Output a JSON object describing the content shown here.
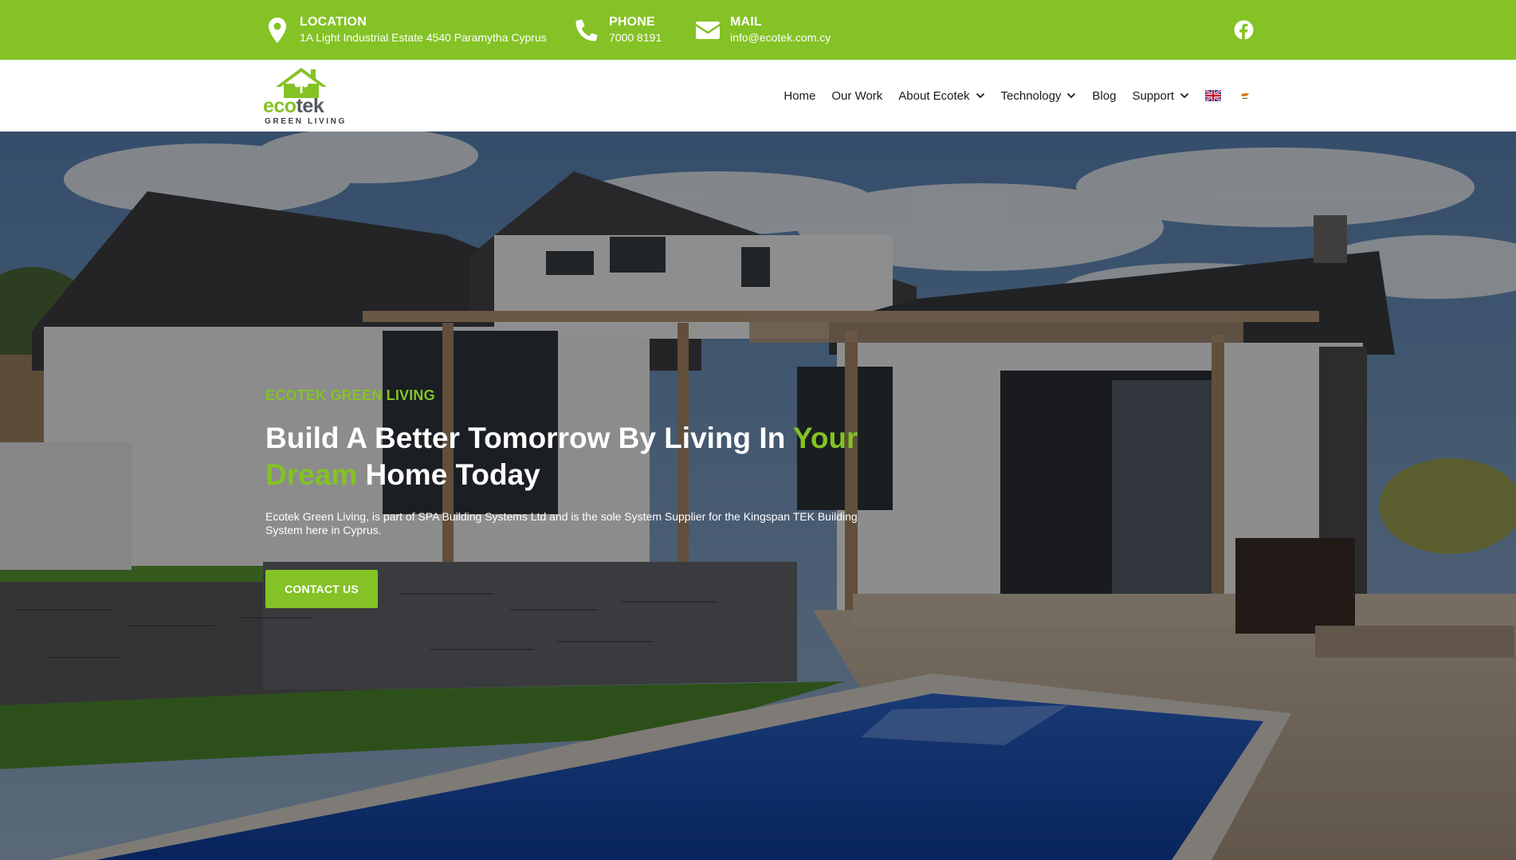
{
  "topbar": {
    "location": {
      "title": "LOCATION",
      "value": "1A Light Industrial Estate 4540 Paramytha Cyprus",
      "icon": "map-pin-icon"
    },
    "phone": {
      "title": "PHONE",
      "value": "7000 8191",
      "icon": "phone-icon"
    },
    "mail": {
      "title": "MAIL",
      "value": "info@ecotek.com.cy",
      "icon": "envelope-icon"
    },
    "social": {
      "icon": "facebook-icon"
    },
    "bg_color": "#84c225"
  },
  "logo": {
    "brand_part1": "eco",
    "brand_part2": "tek",
    "tagline": "GREEN LIVING"
  },
  "nav": {
    "items": [
      {
        "label": "Home",
        "dropdown": false
      },
      {
        "label": "Our Work",
        "dropdown": false
      },
      {
        "label": "About Ecotek",
        "dropdown": true
      },
      {
        "label": "Technology",
        "dropdown": true
      },
      {
        "label": "Blog",
        "dropdown": false
      },
      {
        "label": "Support",
        "dropdown": true
      }
    ],
    "languages": [
      "uk-flag-icon",
      "cyprus-flag-icon"
    ]
  },
  "hero": {
    "eyebrow": "ECOTEK GREEN LIVING",
    "headline_part1": "Build A Better Tomorrow By Living In ",
    "headline_highlight": "Your Dream",
    "headline_part2": " Home Today",
    "description": "Ecotek Green Living, is part of SPA Building Systems Ltd and is the sole System Supplier for the Kingspan TEK Building System here in Cyprus.",
    "cta_label": "CONTACT US"
  },
  "colors": {
    "accent": "#84c225",
    "text_dark": "#1b1b1b"
  }
}
